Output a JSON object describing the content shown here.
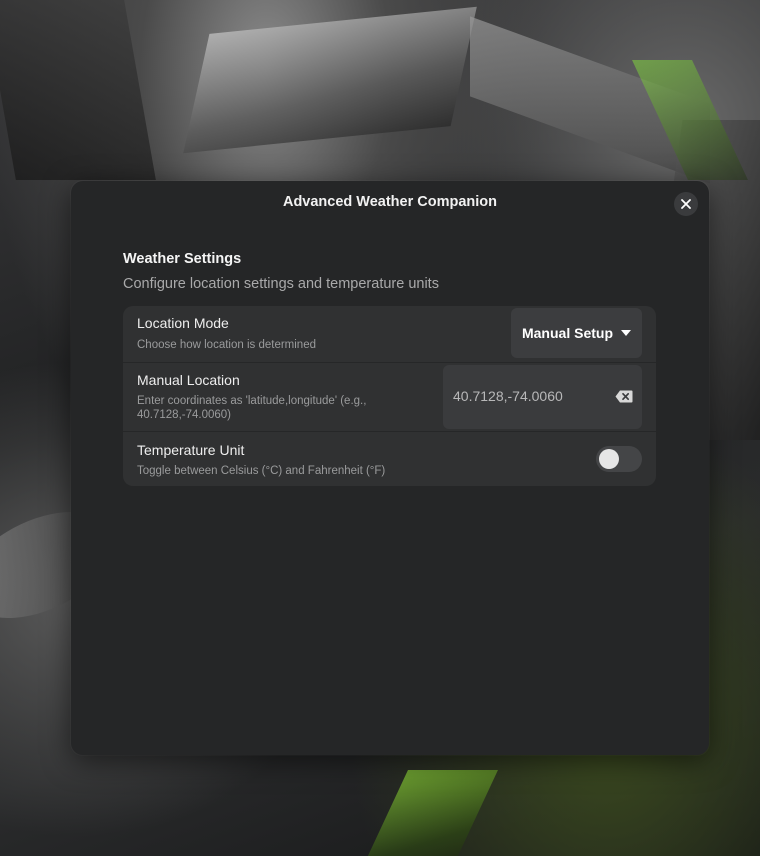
{
  "dialog": {
    "title": "Advanced Weather Companion",
    "close_icon": "close-icon"
  },
  "group": {
    "heading": "Weather Settings",
    "description": "Configure location settings and temperature units"
  },
  "rows": {
    "location_mode": {
      "title": "Location Mode",
      "subtitle": "Choose how location is determined",
      "selected": "Manual Setup",
      "icon": "chevron-down-icon"
    },
    "manual_location": {
      "title": "Manual Location",
      "subtitle_line1": "Enter coordinates as 'latitude,longitude' (e.g.,",
      "subtitle_line2": "40.7128,-74.0060)",
      "value": "40.7128,-74.0060",
      "clear_icon": "backspace-clear-icon"
    },
    "temperature_unit": {
      "title": "Temperature Unit",
      "subtitle": "Toggle between Celsius (°C) and Fahrenheit (°F)",
      "toggle_on": false
    }
  }
}
